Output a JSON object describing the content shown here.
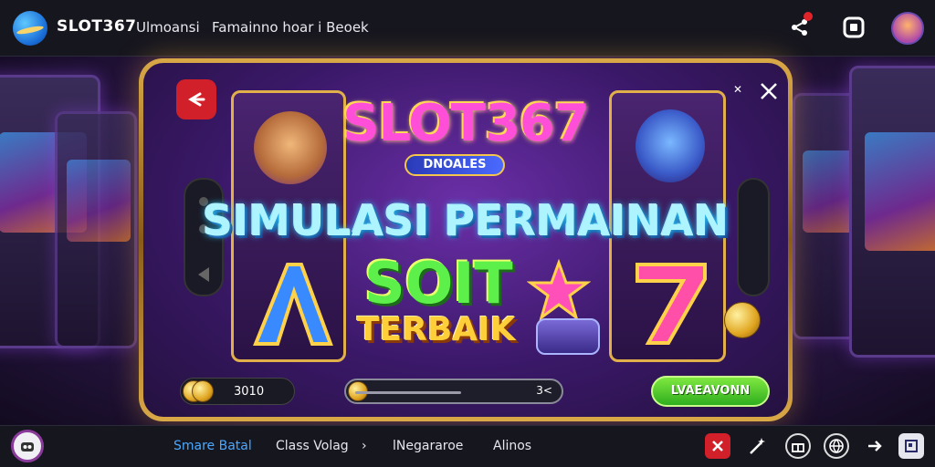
{
  "header": {
    "brand": "SLOT367",
    "nav": [
      "Ulmoansi",
      "Famainno hoar i Beoek"
    ],
    "icons": [
      "share-icon",
      "square-icon",
      "profile-avatar"
    ]
  },
  "game": {
    "title_logo": "SLOT367",
    "badge": "DNOALES",
    "headline": "SIMULASI PERMAINAN",
    "line3": "SOIT",
    "line4": "TERBAIK",
    "balance": "3010",
    "slider_value": "3<",
    "slider_level": 0.58,
    "cta": "LVAEAVONN"
  },
  "footer": {
    "items": [
      {
        "label": "Smare Batal",
        "active": true
      },
      {
        "label": "Class Volag",
        "active": false
      },
      {
        "label": "›",
        "active": false
      },
      {
        "label": "lNegararoe",
        "active": false
      },
      {
        "label": "Alinos",
        "active": false
      }
    ],
    "icons": [
      "red-x-icon",
      "magic-wand-icon",
      "gift-icon",
      "globe-icon",
      "arrow-right-icon",
      "window-icon"
    ]
  },
  "colors": {
    "accent_red": "#d2202a",
    "cta_green": "#2fae1e",
    "gold": "#e2b04a",
    "active_link": "#4aa8ff"
  }
}
